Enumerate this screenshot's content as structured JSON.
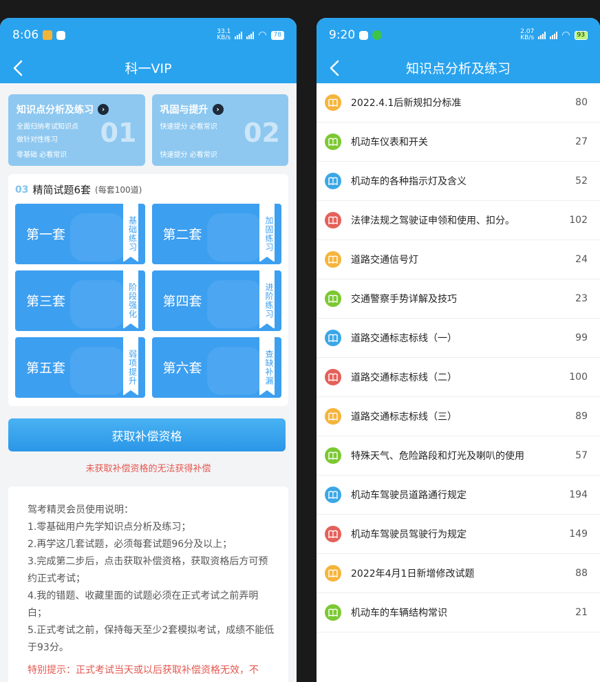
{
  "left": {
    "status": {
      "time": "8:06",
      "net": "33.1\nKB/s",
      "battery": "78"
    },
    "title": "科一VIP",
    "cards": [
      {
        "title": "知识点分析及练习",
        "lines": [
          "全面归纳考试知识点",
          "做针对性练习"
        ],
        "foot": "零基础 必看常识",
        "num": "01"
      },
      {
        "title": "巩固与提升",
        "lines": [
          "快速提分 必看常识"
        ],
        "foot": "快速提分 必看常识",
        "num": "02"
      }
    ],
    "panel": {
      "num": "03",
      "title": "精简试题6套",
      "note": "(每套100道)"
    },
    "sets": [
      {
        "label": "第一套",
        "tag": "基础练习"
      },
      {
        "label": "第二套",
        "tag": "加固练习"
      },
      {
        "label": "第三套",
        "tag": "阶段强化"
      },
      {
        "label": "第四套",
        "tag": "进阶练习"
      },
      {
        "label": "第五套",
        "tag": "弱项提升"
      },
      {
        "label": "第六套",
        "tag": "查缺补漏"
      }
    ],
    "cta": "获取补偿资格",
    "warning": "未获取补偿资格的无法获得补偿",
    "instructions": {
      "heading": "驾考精灵会员使用说明：",
      "items": [
        "1.零基础用户先学知识点分析及练习；",
        "2.再学这几套试题，必须每套试题96分及以上；",
        "3.完成第二步后，点击获取补偿资格，获取资格后方可预约正式考试；",
        "4.我的错题、收藏里面的试题必须在正式考试之前弄明白；",
        "5.正式考试之前，保持每天至少2套模拟考试，成绩不能低于93分。"
      ],
      "tip": "特别提示：正式考试当天或以后获取补偿资格无效，不"
    }
  },
  "right": {
    "status": {
      "time": "9:20",
      "net": "2.07\nKB/s",
      "battery": "93"
    },
    "title": "知识点分析及练习",
    "colors": {
      "orange": "#f5b43c",
      "green": "#7cc832",
      "blue": "#3ba7e6",
      "red": "#e4615a"
    },
    "items": [
      {
        "label": "2022.4.1后新规扣分标准",
        "count": "80",
        "color": "#f5b43c"
      },
      {
        "label": "机动车仪表和开关",
        "count": "27",
        "color": "#7cc832"
      },
      {
        "label": "机动车的各种指示灯及含义",
        "count": "52",
        "color": "#3ba7e6"
      },
      {
        "label": "法律法规之驾驶证申领和使用、扣分。",
        "count": "102",
        "color": "#e4615a"
      },
      {
        "label": "道路交通信号灯",
        "count": "24",
        "color": "#f5b43c"
      },
      {
        "label": "交通警察手势详解及技巧",
        "count": "23",
        "color": "#7cc832"
      },
      {
        "label": "道路交通标志标线（一）",
        "count": "99",
        "color": "#3ba7e6"
      },
      {
        "label": "道路交通标志标线（二）",
        "count": "100",
        "color": "#e4615a"
      },
      {
        "label": "道路交通标志标线（三）",
        "count": "89",
        "color": "#f5b43c"
      },
      {
        "label": "特殊天气、危险路段和灯光及喇叭的使用",
        "count": "57",
        "color": "#7cc832"
      },
      {
        "label": "机动车驾驶员道路通行规定",
        "count": "194",
        "color": "#3ba7e6"
      },
      {
        "label": "机动车驾驶员驾驶行为规定",
        "count": "149",
        "color": "#e4615a"
      },
      {
        "label": "2022年4月1日新增修改试题",
        "count": "88",
        "color": "#f5b43c"
      },
      {
        "label": "机动车的车辆结构常识",
        "count": "21",
        "color": "#7cc832"
      }
    ]
  }
}
